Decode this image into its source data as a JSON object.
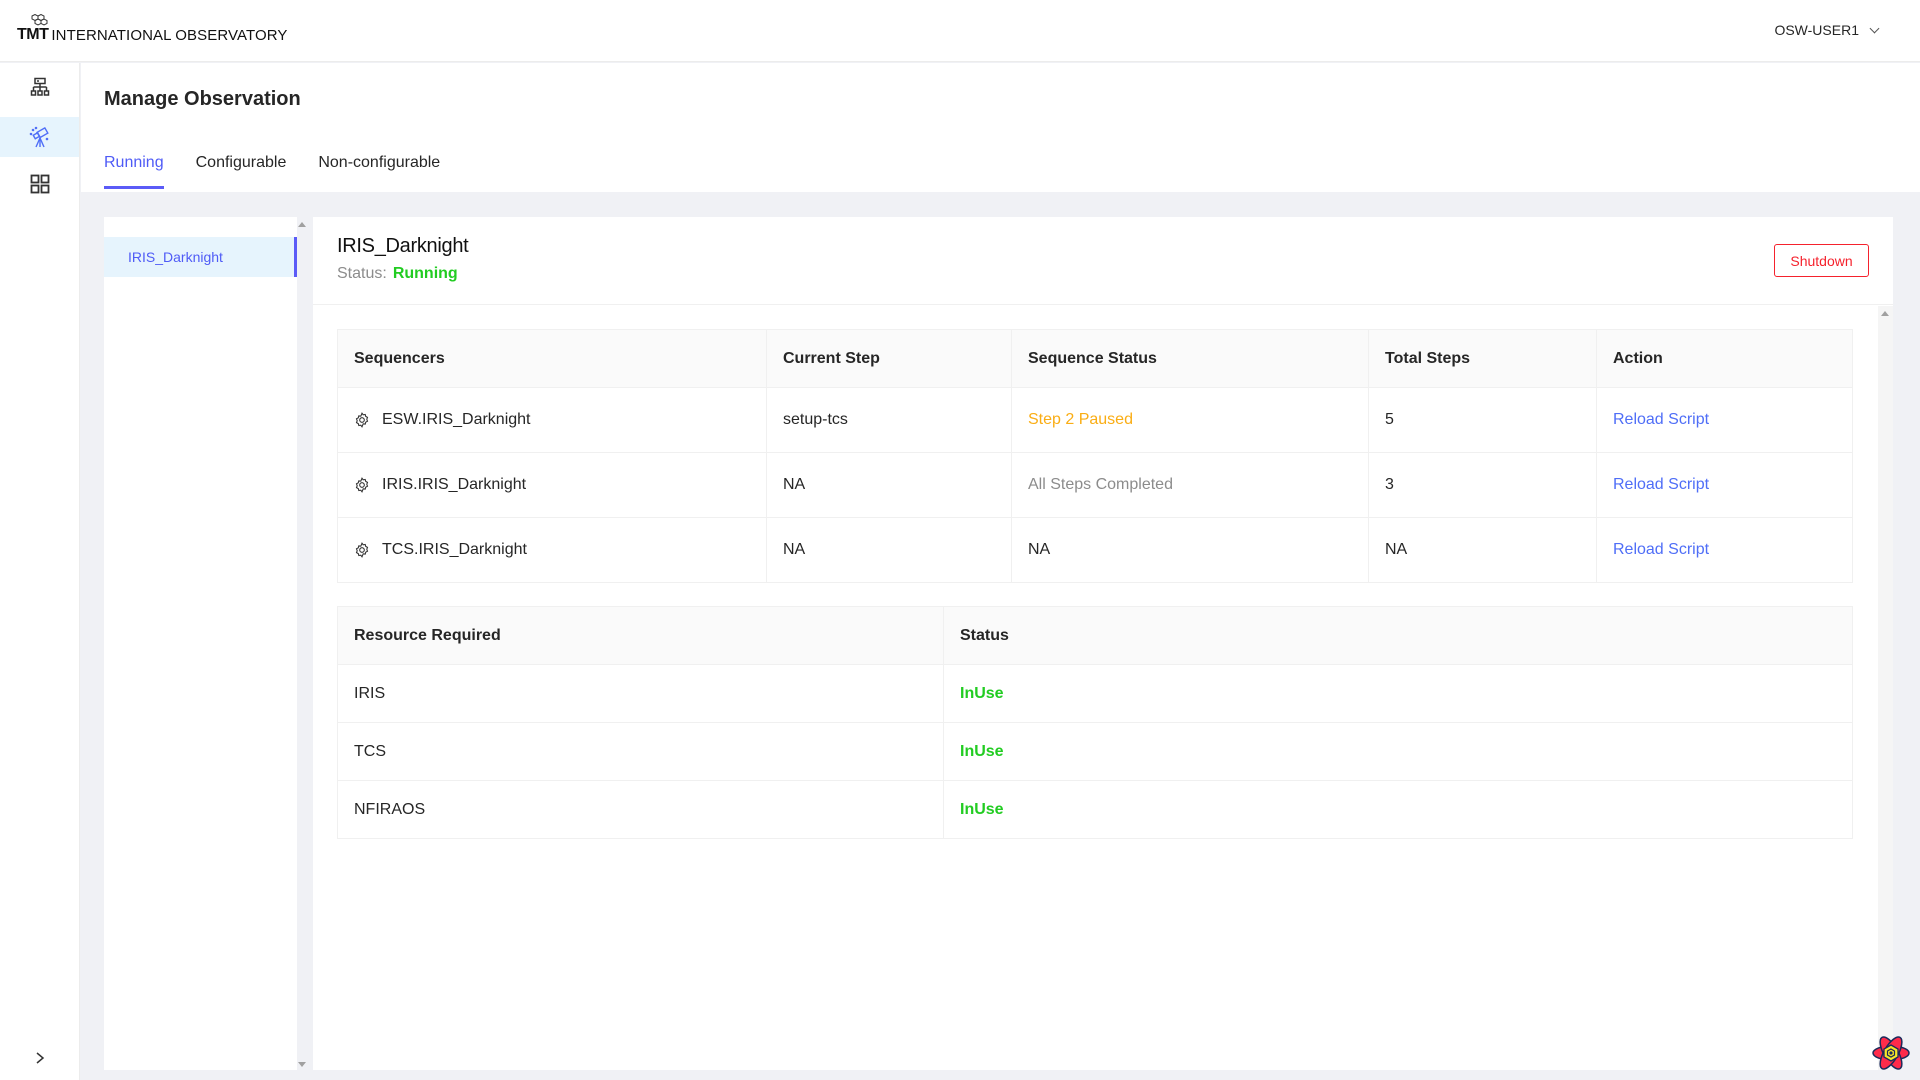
{
  "header": {
    "logo_mark": "TMT",
    "logo_text": "INTERNATIONAL OBSERVATORY",
    "user": "OSW-USER1"
  },
  "sidebar": {
    "items": [
      {
        "icon": "infrastructure-icon",
        "active": false
      },
      {
        "icon": "telescope-icon",
        "active": true
      },
      {
        "icon": "grid-icon",
        "active": false
      }
    ],
    "toggle_icon": "chevron-right-icon"
  },
  "page": {
    "title": "Manage Observation",
    "tabs": [
      {
        "label": "Running",
        "active": true
      },
      {
        "label": "Configurable",
        "active": false
      },
      {
        "label": "Non-configurable",
        "active": false
      }
    ]
  },
  "observations": [
    {
      "name": "IRIS_Darknight",
      "selected": true
    }
  ],
  "detail": {
    "title": "IRIS_Darknight",
    "status_label": "Status:",
    "status_value": "Running",
    "shutdown_label": "Shutdown",
    "sequencers": {
      "columns": [
        "Sequencers",
        "Current Step",
        "Sequence Status",
        "Total Steps",
        "Action"
      ],
      "rows": [
        {
          "name": "ESW.IRIS_Darknight",
          "current_step": "setup-tcs",
          "status": "Step 2 Paused",
          "status_type": "paused",
          "total_steps": "5",
          "action": "Reload Script"
        },
        {
          "name": "IRIS.IRIS_Darknight",
          "current_step": "NA",
          "status": "All Steps Completed",
          "status_type": "done",
          "total_steps": "3",
          "action": "Reload Script"
        },
        {
          "name": "TCS.IRIS_Darknight",
          "current_step": "NA",
          "status": "NA",
          "status_type": "na",
          "total_steps": "NA",
          "action": "Reload Script"
        }
      ]
    },
    "resources": {
      "columns": [
        "Resource Required",
        "Status"
      ],
      "rows": [
        {
          "name": "IRIS",
          "status": "InUse"
        },
        {
          "name": "TCS",
          "status": "InUse"
        },
        {
          "name": "NFIRAOS",
          "status": "InUse"
        }
      ]
    }
  },
  "colors": {
    "accent": "#5b5bf7",
    "running": "#22cc22",
    "paused": "#faad14",
    "danger": "#f5222d",
    "link": "#4f6ef7"
  }
}
